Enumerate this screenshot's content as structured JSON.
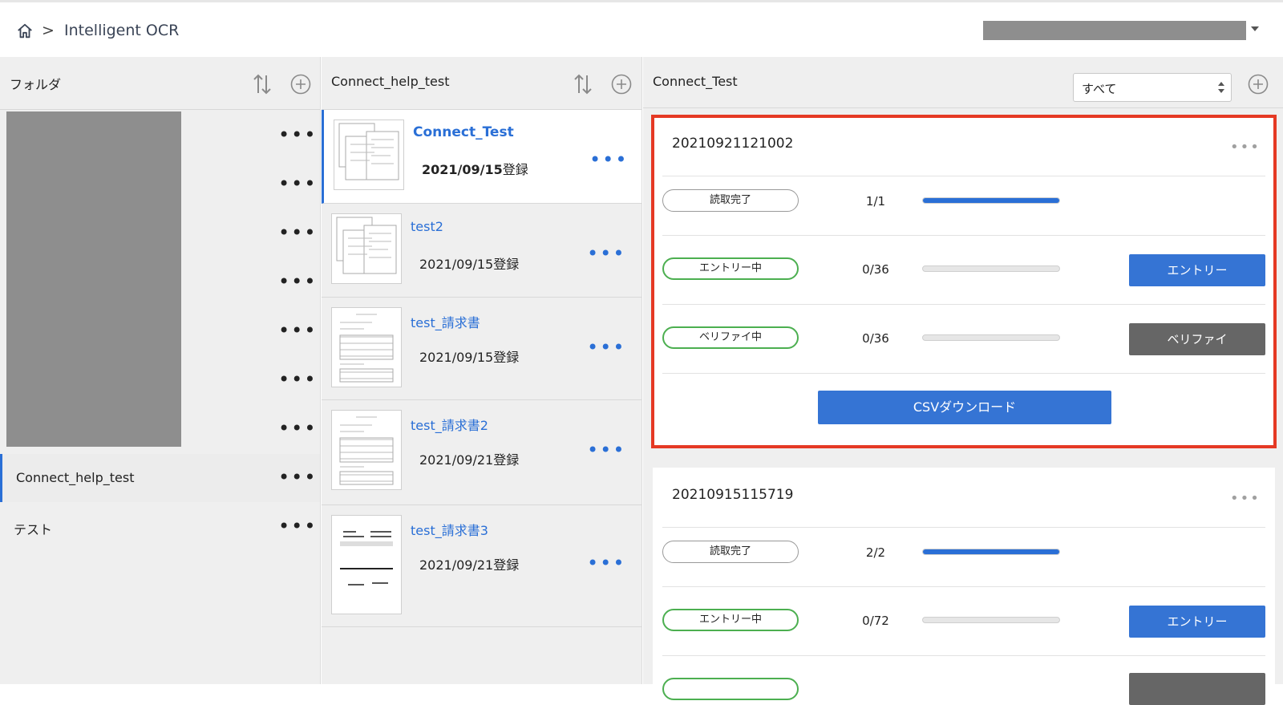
{
  "topbar": {
    "breadcrumb_separator": ">",
    "app_title": "Intelligent OCR",
    "home_icon": "home-icon",
    "account_caret_icon": "chevron-down-icon"
  },
  "folders": {
    "header_title": "フォルダ",
    "items": [
      {
        "label": ""
      },
      {
        "label": ""
      },
      {
        "label": ""
      },
      {
        "label": ""
      },
      {
        "label": ""
      },
      {
        "label": ""
      },
      {
        "label": ""
      },
      {
        "label": "Connect_help_test"
      },
      {
        "label": "テスト"
      }
    ],
    "more_label": "•••"
  },
  "documents": {
    "header_title": "Connect_help_test",
    "items": [
      {
        "name": "Connect_Test",
        "date": "2021/09/15",
        "date_suffix": "登録"
      },
      {
        "name": "test2",
        "date": "2021/09/15",
        "date_suffix": "登録"
      },
      {
        "name": "test_請求書",
        "date": "2021/09/15",
        "date_suffix": "登録"
      },
      {
        "name": "test_請求書2",
        "date": "2021/09/21",
        "date_suffix": "登録"
      },
      {
        "name": "test_請求書3",
        "date": "2021/09/21",
        "date_suffix": "登録"
      }
    ],
    "more_label": "•••"
  },
  "detail": {
    "header_title": "Connect_Test",
    "filter_value": "すべて",
    "batches": [
      {
        "id": "20210921121002",
        "more_label": "•••",
        "rows": [
          {
            "status": "読取完了",
            "count": "1/1",
            "progress": 1.0,
            "action": ""
          },
          {
            "status": "エントリー中",
            "count": "0/36",
            "progress": 0.0,
            "action": "エントリー"
          },
          {
            "status": "ベリファイ中",
            "count": "0/36",
            "progress": 0.0,
            "action": "ベリファイ"
          }
        ],
        "csv_label": "CSVダウンロード"
      },
      {
        "id": "20210915115719",
        "more_label": "•••",
        "rows": [
          {
            "status": "読取完了",
            "count": "2/2",
            "progress": 1.0,
            "action": ""
          },
          {
            "status": "エントリー中",
            "count": "0/72",
            "progress": 0.0,
            "action": "エントリー"
          }
        ]
      }
    ]
  },
  "colors": {
    "accent": "#2a6fd6",
    "highlight": "#e53924",
    "status_green": "#4caf50",
    "verify_gray": "#666666"
  }
}
